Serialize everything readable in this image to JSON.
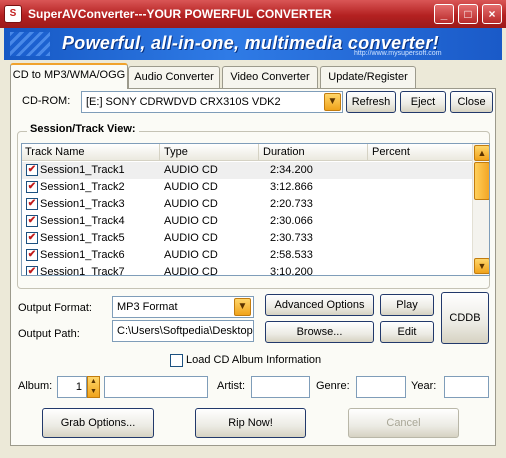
{
  "window": {
    "app_logo_text": "S",
    "title": "SuperAVConverter---YOUR POWERFUL CONVERTER",
    "minimize": "_",
    "maximize": "□",
    "close": "×"
  },
  "banner": {
    "title": "Powerful, all-in-one, multimedia converter!",
    "url": "http://www.mysupersoft.com"
  },
  "tabs": [
    {
      "label": "CD to MP3/WMA/OGG",
      "active": true
    },
    {
      "label": "Audio Converter",
      "active": false
    },
    {
      "label": "Video Converter",
      "active": false
    },
    {
      "label": "Update/Register",
      "active": false
    }
  ],
  "cdrom": {
    "label": "CD-ROM:",
    "drive_value": "[E:] SONY     CDRWDVD CRX310S  VDK2",
    "refresh": "Refresh",
    "eject": "Eject",
    "close": "Close"
  },
  "track_view": {
    "title": "Session/Track View:",
    "columns": [
      "Track Name",
      "Type",
      "Duration",
      "Percent"
    ],
    "rows": [
      {
        "name": "Session1_Track1",
        "type": "AUDIO CD",
        "duration": "2:34.200",
        "percent": "",
        "checked": true
      },
      {
        "name": "Session1_Track2",
        "type": "AUDIO CD",
        "duration": "3:12.866",
        "percent": "",
        "checked": true
      },
      {
        "name": "Session1_Track3",
        "type": "AUDIO CD",
        "duration": "2:20.733",
        "percent": "",
        "checked": true
      },
      {
        "name": "Session1_Track4",
        "type": "AUDIO CD",
        "duration": "2:30.066",
        "percent": "",
        "checked": true
      },
      {
        "name": "Session1_Track5",
        "type": "AUDIO CD",
        "duration": "2:30.733",
        "percent": "",
        "checked": true
      },
      {
        "name": "Session1_Track6",
        "type": "AUDIO CD",
        "duration": "2:58.533",
        "percent": "",
        "checked": true
      },
      {
        "name": "Session1_Track7",
        "type": "AUDIO CD",
        "duration": "3:10.200",
        "percent": "",
        "checked": true
      }
    ],
    "scroll_up": "▲",
    "scroll_down": "▼"
  },
  "output": {
    "format_label": "Output Format:",
    "format_value": "MP3 Format",
    "path_label": "Output Path:",
    "path_value": "C:\\Users\\Softpedia\\Desktop",
    "advanced": "Advanced Options",
    "browse": "Browse...",
    "play": "Play",
    "edit": "Edit",
    "cddb": "CDDB",
    "combo_arrow": "▼"
  },
  "album_info": {
    "load_label": "Load CD Album Information",
    "load_checked": false,
    "album_label": "Album:",
    "album_number": "1",
    "album_value": "",
    "artist_label": "Artist:",
    "artist_value": "",
    "genre_label": "Genre:",
    "genre_value": "",
    "year_label": "Year:",
    "year_value": "",
    "spin_up": "▲",
    "spin_down": "▼"
  },
  "actions": {
    "grab_options": "Grab Options...",
    "rip_now": "Rip Now!",
    "cancel": "Cancel"
  }
}
